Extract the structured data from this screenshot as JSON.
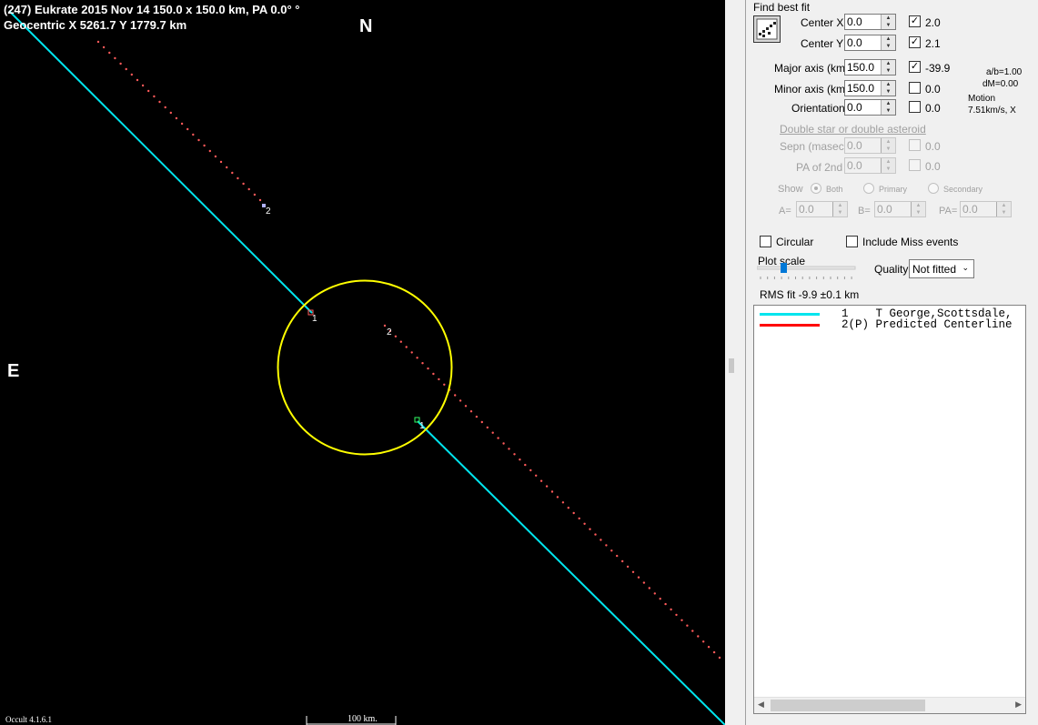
{
  "plot": {
    "header_line1": "(247) Eukrate  2015 Nov 14   150.0 x 150.0 km, PA 0.0° °",
    "header_line2": "Geocentric  X  5261.7  Y 1779.7 km",
    "north": "N",
    "east": "E",
    "version": "Occult 4.1.6.1",
    "scale_label": "100 km.",
    "chord_labels": [
      "1",
      "2",
      "2",
      "1"
    ],
    "colors": {
      "background": "#000000",
      "observed_chord": "#00e5ee",
      "ellipse": "#ffff00",
      "predicted": "#ff4d4d"
    }
  },
  "panel": {
    "find_best_fit": "Find best fit",
    "center_x": {
      "label": "Center X",
      "value": "0.0",
      "check_label": "2.0",
      "checked": true
    },
    "center_y": {
      "label": "Center Y",
      "value": "0.0",
      "check_label": "2.1",
      "checked": true
    },
    "major_axis": {
      "label": "Major axis (km)",
      "value": "150.0",
      "check_label": "-39.9",
      "checked": true
    },
    "minor_axis": {
      "label": "Minor axis (km)",
      "value": "150.0",
      "check_label": "0.0",
      "checked": false
    },
    "orientation": {
      "label": "Orientation",
      "value": "0.0",
      "check_label": "0.0",
      "checked": false
    },
    "ab_ratio": "a/b=1.00",
    "dm": "dM=0.00",
    "motion_label": "Motion",
    "motion_value": "7.51km/s, X",
    "double_star_link": "Double star  or  double asteroid",
    "sepn": {
      "label": "Sepn (masec)",
      "value": "0.0",
      "check_label": "0.0"
    },
    "pa2": {
      "label": "PA of 2nd",
      "value": "0.0",
      "check_label": "0.0"
    },
    "show_label": "Show",
    "show_options": [
      "Both",
      "Primary",
      "Secondary"
    ],
    "a_label": "A=",
    "a_value": "0.0",
    "b_label": "B=",
    "b_value": "0.0",
    "pa_label": "PA=",
    "pa_value": "0.0",
    "circular_label": "Circular",
    "include_miss_label": "Include Miss events",
    "plot_scale_label": "Plot scale",
    "quality_label": "Quality",
    "quality_value": "Not fitted",
    "rms_fit": "RMS fit  -9.9 ±0.1 km",
    "legend": [
      {
        "num": "1",
        "text": "T George,Scottsdale,",
        "color": "#00e5ee"
      },
      {
        "num": "2(P)",
        "text": "Predicted Centerline",
        "color": "#ff0000"
      }
    ]
  }
}
